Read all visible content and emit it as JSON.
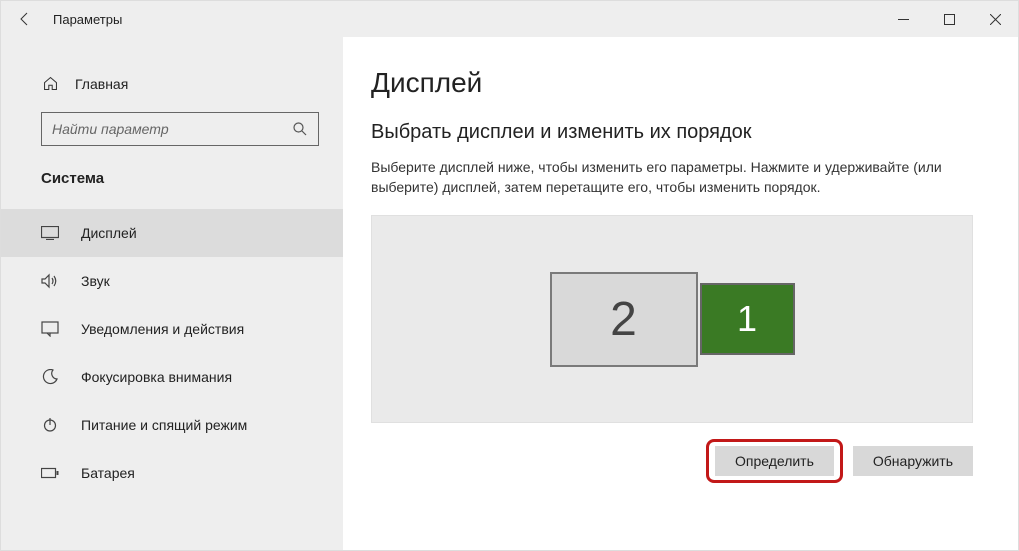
{
  "window": {
    "title": "Параметры"
  },
  "sidebar": {
    "home": "Главная",
    "search": {
      "placeholder": "Найти параметр"
    },
    "section": "Система",
    "items": [
      {
        "label": "Дисплей"
      },
      {
        "label": "Звук"
      },
      {
        "label": "Уведомления и действия"
      },
      {
        "label": "Фокусировка внимания"
      },
      {
        "label": "Питание и спящий режим"
      },
      {
        "label": "Батарея"
      }
    ]
  },
  "main": {
    "title": "Дисплей",
    "arrange": {
      "heading": "Выбрать дисплеи и изменить их порядок",
      "description": "Выберите дисплей ниже, чтобы изменить его параметры. Нажмите и удерживайте (или выберите) дисплей, затем перетащите его, чтобы изменить порядок.",
      "displays": [
        {
          "id": "2",
          "selected": false
        },
        {
          "id": "1",
          "selected": true
        }
      ]
    },
    "buttons": {
      "identify": "Определить",
      "detect": "Обнаружить"
    }
  }
}
